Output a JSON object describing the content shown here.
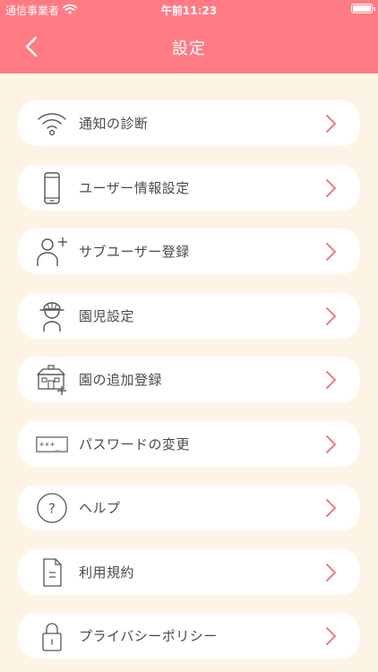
{
  "status_bar": {
    "carrier": "通信事業者",
    "time": "午前11:23"
  },
  "nav": {
    "title": "設定"
  },
  "colors": {
    "header": "#ff7b84",
    "background": "#fdf4e5",
    "chevron": "#f07a82",
    "icon": "#555555"
  },
  "menu": [
    {
      "label": "通知の診断",
      "icon": "wifi-icon"
    },
    {
      "label": "ユーザー情報設定",
      "icon": "phone-icon"
    },
    {
      "label": "サブユーザー登録",
      "icon": "add-user-icon"
    },
    {
      "label": "園児設定",
      "icon": "child-hat-icon"
    },
    {
      "label": "園の追加登録",
      "icon": "school-add-icon"
    },
    {
      "label": "パスワードの変更",
      "icon": "password-icon"
    },
    {
      "label": "ヘルプ",
      "icon": "help-icon"
    },
    {
      "label": "利用規約",
      "icon": "document-icon"
    },
    {
      "label": "プライバシーポリシー",
      "icon": "lock-icon"
    }
  ]
}
